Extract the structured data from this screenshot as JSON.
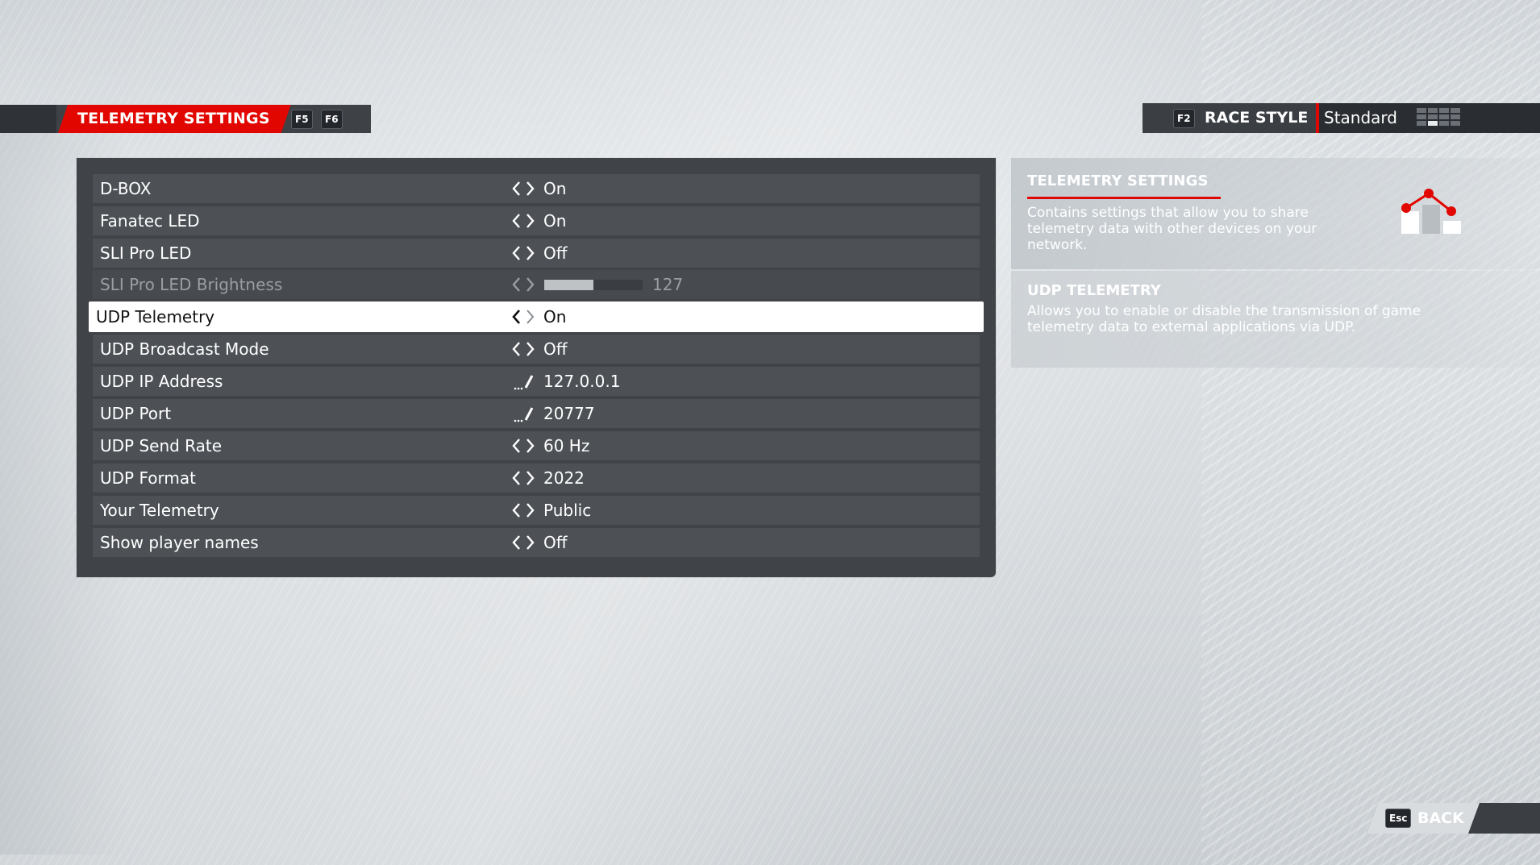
{
  "header": {
    "title": "TELEMETRY SETTINGS",
    "key_prev": "F5",
    "key_next": "F6",
    "race_style_key": "F2",
    "race_style_label": "RACE STYLE",
    "race_style_value": "Standard"
  },
  "settings": [
    {
      "label": "D-BOX",
      "control": "toggle",
      "value": "On",
      "state": "normal"
    },
    {
      "label": "Fanatec LED",
      "control": "toggle",
      "value": "On",
      "state": "normal"
    },
    {
      "label": "SLI Pro LED",
      "control": "toggle",
      "value": "Off",
      "state": "normal"
    },
    {
      "label": "SLI Pro LED Brightness",
      "control": "slider",
      "value": "127",
      "fill": 0.5,
      "state": "disabled"
    },
    {
      "label": "UDP Telemetry",
      "control": "toggle",
      "value": "On",
      "state": "selected"
    },
    {
      "label": "UDP Broadcast Mode",
      "control": "toggle",
      "value": "Off",
      "state": "normal"
    },
    {
      "label": "UDP IP Address",
      "control": "edit",
      "value": "127.0.0.1",
      "state": "normal"
    },
    {
      "label": "UDP Port",
      "control": "edit",
      "value": "20777",
      "state": "normal"
    },
    {
      "label": "UDP Send Rate",
      "control": "toggle",
      "value": "60 Hz",
      "state": "normal"
    },
    {
      "label": "UDP Format",
      "control": "toggle",
      "value": "2022",
      "state": "normal"
    },
    {
      "label": "Your Telemetry",
      "control": "toggle",
      "value": "Public",
      "state": "normal"
    },
    {
      "label": "Show player names",
      "control": "toggle",
      "value": "Off",
      "state": "normal"
    }
  ],
  "info": {
    "title": "TELEMETRY SETTINGS",
    "description": "Contains settings that allow you to share telemetry data with other devices on your network.",
    "icon": "telemetry-chart-icon"
  },
  "detail": {
    "title": "UDP TELEMETRY",
    "description": "Allows you to enable or disable the transmission of game telemetry data to external applications via UDP."
  },
  "footer": {
    "back_key": "Esc",
    "back_label": "BACK"
  },
  "colors": {
    "accent": "#e10600",
    "panel": "#404449",
    "row": "#4d5156",
    "selected_row": "#ffffff"
  }
}
